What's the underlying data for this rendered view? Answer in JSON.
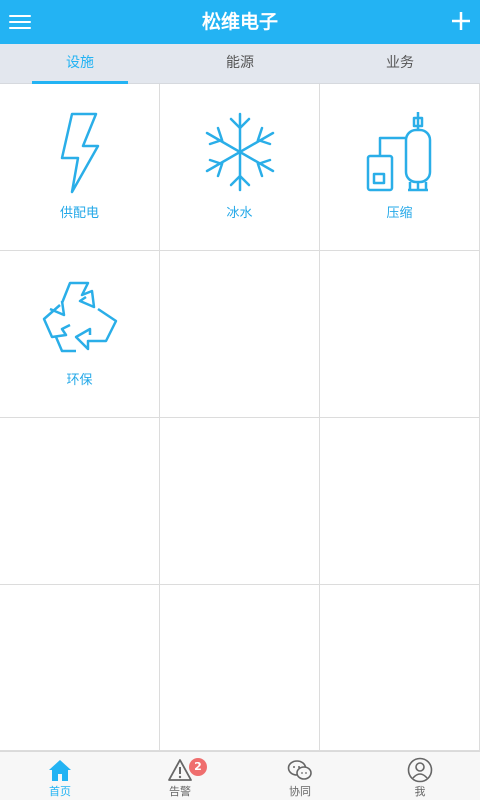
{
  "header": {
    "title": "松维电子",
    "menu_icon": "menu-icon",
    "add_icon": "plus-icon"
  },
  "tabs": [
    {
      "label": "设施",
      "active": true
    },
    {
      "label": "能源",
      "active": false
    },
    {
      "label": "业务",
      "active": false
    }
  ],
  "grid": {
    "items": [
      {
        "label": "供配电",
        "icon": "lightning-icon"
      },
      {
        "label": "冰水",
        "icon": "snowflake-icon"
      },
      {
        "label": "压缩",
        "icon": "compressor-icon"
      },
      {
        "label": "环保",
        "icon": "recycle-icon"
      }
    ]
  },
  "bottom_nav": [
    {
      "label": "首页",
      "icon": "home-icon",
      "active": true
    },
    {
      "label": "告警",
      "icon": "alert-icon",
      "active": false,
      "badge": "2"
    },
    {
      "label": "协同",
      "icon": "chat-icon",
      "active": false
    },
    {
      "label": "我",
      "icon": "user-icon",
      "active": false
    }
  ],
  "colors": {
    "accent": "#23b3f3",
    "badge": "#ef6e6e",
    "tab_bg": "#e3e7ee"
  }
}
